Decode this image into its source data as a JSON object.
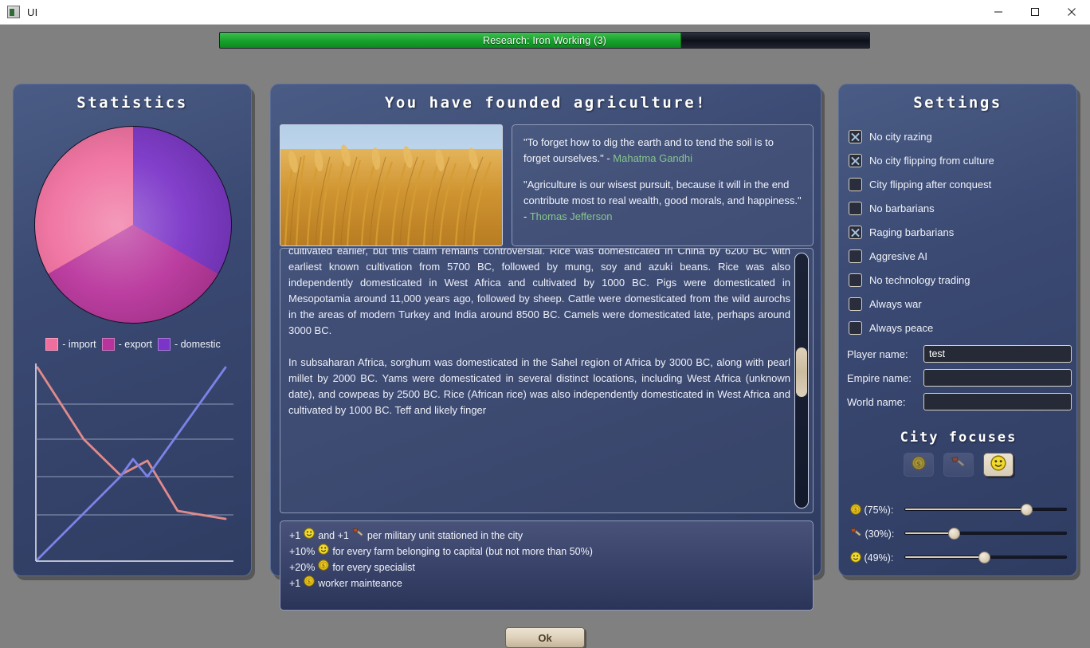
{
  "window": {
    "title": "UI",
    "icon": "app-icon",
    "controls": {
      "minimize": "–",
      "maximize": "□",
      "close": "✕"
    }
  },
  "research": {
    "label": "Research: Iron Working (3)",
    "progress_percent": 71,
    "fill_color": "#17a02c",
    "track_color": "#0d1018"
  },
  "statistics": {
    "title": "Statistics",
    "legend": [
      {
        "label": "- import",
        "color": "#ef6e9d"
      },
      {
        "label": "- export",
        "color": "#b8339b"
      },
      {
        "label": "- domestic",
        "color": "#7b34c8"
      }
    ]
  },
  "chart_data": [
    {
      "type": "pie",
      "title": "Statistics",
      "labels": [
        "domestic",
        "export",
        "import"
      ],
      "values": [
        33.3,
        33.3,
        33.3
      ],
      "colors": [
        "#7b34c8",
        "#b8339b",
        "#ef6e9d"
      ],
      "legend_position": "bottom"
    },
    {
      "type": "line",
      "title": "",
      "xlabel": "",
      "ylabel": "",
      "grid": true,
      "ylim": [
        0,
        100
      ],
      "x": [
        0,
        1,
        2,
        3,
        4,
        5,
        6
      ],
      "series": [
        {
          "name": "declining",
          "color": "#e08b8b",
          "values": [
            100,
            66,
            52,
            40,
            28,
            14,
            10
          ]
        },
        {
          "name": "rising",
          "color": "#7b83e8",
          "values": [
            0,
            17,
            34,
            46,
            38,
            70,
            100
          ]
        }
      ]
    }
  ],
  "center": {
    "title": "You have founded agriculture!",
    "hero_image": "wheat-field-photo",
    "quotes": [
      {
        "text": "\"To forget how to dig the earth and to tend the soil is to forget ourselves.\" - ",
        "author": "Mahatma Gandhi"
      },
      {
        "text": "\"Agriculture is our wisest pursuit, because it will in the end contribute most to real wealth, good morals, and happiness.\" - ",
        "author": "Thomas Jefferson"
      }
    ],
    "article": {
      "paragraph_1": "barley, peas, lentils, bitter vetch, chickpeas, and flax - were cultivated in the Levant. Rye may have been cultivated earlier, but this claim remains controversial. Rice was domesticated in China by 6200 BC with earliest known cultivation from 5700 BC, followed by mung, soy and azuki beans. Rice was also independently domesticated in West Africa and cultivated by 1000 BC. Pigs were domesticated in Mesopotamia around 11,000 years ago, followed by sheep. Cattle were domesticated from the wild aurochs in the areas of modern Turkey and India around 8500 BC. Camels were domesticated late, perhaps around 3000 BC.",
      "paragraph_2": "In subsaharan Africa, sorghum was domesticated in the Sahel region of Africa by 3000 BC, along with pearl millet by 2000 BC. Yams were domesticated in several distinct locations, including West Africa (unknown date), and cowpeas by 2500 BC. Rice (African rice) was also independently domesticated in West Africa and cultivated by 1000 BC. Teff and likely finger"
    },
    "bonuses": [
      {
        "prefix": "+1",
        "icon_1": "happy-icon",
        "mid": "and +1",
        "icon_2": "hammer-icon",
        "text": "per military unit stationed in the city"
      },
      {
        "prefix": "+10%",
        "icon_1": "happy-icon",
        "mid": "",
        "icon_2": "",
        "text": "for every farm belonging to capital (but not more than 50%)"
      },
      {
        "prefix": "+20%",
        "icon_1": "gold-icon",
        "mid": "",
        "icon_2": "",
        "text": "for every specialist"
      },
      {
        "prefix": "+1",
        "icon_1": "gold-icon",
        "mid": "",
        "icon_2": "",
        "text": "worker mainteance"
      }
    ],
    "ok_button": "Ok"
  },
  "settings": {
    "title": "Settings",
    "checkboxes": [
      {
        "label": "No city razing",
        "checked": true
      },
      {
        "label": "No city flipping from culture",
        "checked": true
      },
      {
        "label": "City flipping after conquest",
        "checked": false
      },
      {
        "label": "No barbarians",
        "checked": false
      },
      {
        "label": "Raging barbarians",
        "checked": true
      },
      {
        "label": "Aggresive AI",
        "checked": false
      },
      {
        "label": "No technology trading",
        "checked": false
      },
      {
        "label": "Always war",
        "checked": false
      },
      {
        "label": "Always peace",
        "checked": false
      }
    ],
    "fields": [
      {
        "label": "Player name:",
        "value": "test",
        "placeholder": ""
      },
      {
        "label": "Empire name:",
        "value": "",
        "placeholder": ""
      },
      {
        "label": "World name:",
        "value": "",
        "placeholder": ""
      }
    ],
    "city_focuses": {
      "title": "City focuses",
      "buttons": [
        {
          "icon": "gold-icon",
          "active": false
        },
        {
          "icon": "hammer-icon",
          "active": false
        },
        {
          "icon": "happy-icon",
          "active": true
        }
      ]
    },
    "sliders": [
      {
        "icon": "gold-icon",
        "label": "(75%):",
        "value": 75
      },
      {
        "icon": "hammer-icon",
        "label": "(30%):",
        "value": 30
      },
      {
        "icon": "happy-icon",
        "label": "(49%):",
        "value": 49
      }
    ]
  }
}
